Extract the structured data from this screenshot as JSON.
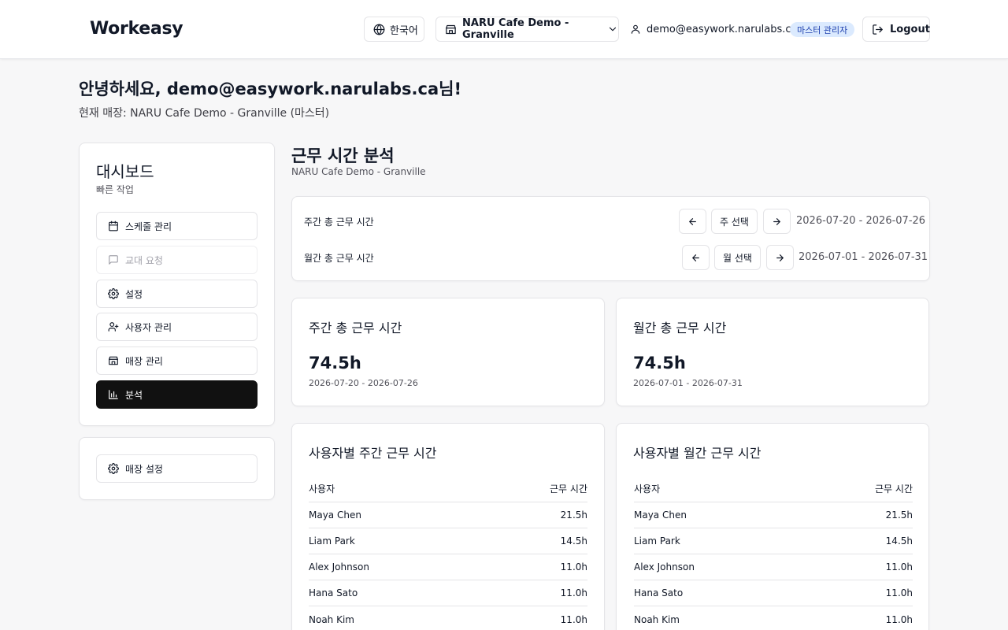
{
  "header": {
    "brand": "Workeasy",
    "language": "한국어",
    "store": "NARU Cafe Demo - Granville",
    "user_email": "demo@easywork.narulabs.ca",
    "role_badge": "마스터 관리자",
    "logout": "Logout"
  },
  "greeting": {
    "title": "안녕하세요, demo@easywork.narulabs.ca님!",
    "current_store": "현재 매장: NARU Cafe Demo - Granville (마스터)"
  },
  "sidebar": {
    "title": "대시보드",
    "subtitle": "빠른 작업",
    "items": [
      {
        "label": "스케줄 관리",
        "icon": "calendar-icon"
      },
      {
        "label": "교대 요청",
        "icon": "message-icon",
        "disabled": true
      },
      {
        "label": "설정",
        "icon": "gear-icon"
      },
      {
        "label": "사용자 관리",
        "icon": "user-plus-icon"
      },
      {
        "label": "매장 관리",
        "icon": "store-icon"
      },
      {
        "label": "분석",
        "icon": "bar-chart-icon",
        "active": true
      }
    ],
    "store_settings": "매장 설정"
  },
  "main": {
    "title": "근무 시간 분석",
    "subtitle": "NARU Cafe Demo - Granville",
    "filters": {
      "weekly_label": "주간 총 근무 시간",
      "week_select": "주 선택",
      "week_range": "2026-07-20 - 2026-07-26",
      "monthly_label": "월간 총 근무 시간",
      "month_select": "월 선택",
      "month_range": "2026-07-01 - 2026-07-31"
    },
    "weekly_card": {
      "title": "주간 총 근무 시간",
      "value": "74.5h",
      "range": "2026-07-20 - 2026-07-26"
    },
    "monthly_card": {
      "title": "월간 총 근무 시간",
      "value": "74.5h",
      "range": "2026-07-01 - 2026-07-31"
    },
    "weekly_table": {
      "title": "사용자별 주간 근무 시간",
      "col_user": "사용자",
      "col_hours": "근무 시간",
      "rows": [
        {
          "name": "Maya Chen",
          "hours": "21.5h"
        },
        {
          "name": "Liam Park",
          "hours": "14.5h"
        },
        {
          "name": "Alex Johnson",
          "hours": "11.0h"
        },
        {
          "name": "Hana Sato",
          "hours": "11.0h"
        },
        {
          "name": "Noah Kim",
          "hours": "11.0h"
        }
      ]
    },
    "monthly_table": {
      "title": "사용자별 월간 근무 시간",
      "col_user": "사용자",
      "col_hours": "근무 시간",
      "rows": [
        {
          "name": "Maya Chen",
          "hours": "21.5h"
        },
        {
          "name": "Liam Park",
          "hours": "14.5h"
        },
        {
          "name": "Alex Johnson",
          "hours": "11.0h"
        },
        {
          "name": "Hana Sato",
          "hours": "11.0h"
        },
        {
          "name": "Noah Kim",
          "hours": "11.0h"
        }
      ]
    }
  },
  "colors": {
    "accent": "#111111",
    "badge_bg": "#dbeafe",
    "badge_text": "#1e40af",
    "page_bg": "#f7f7f8"
  }
}
